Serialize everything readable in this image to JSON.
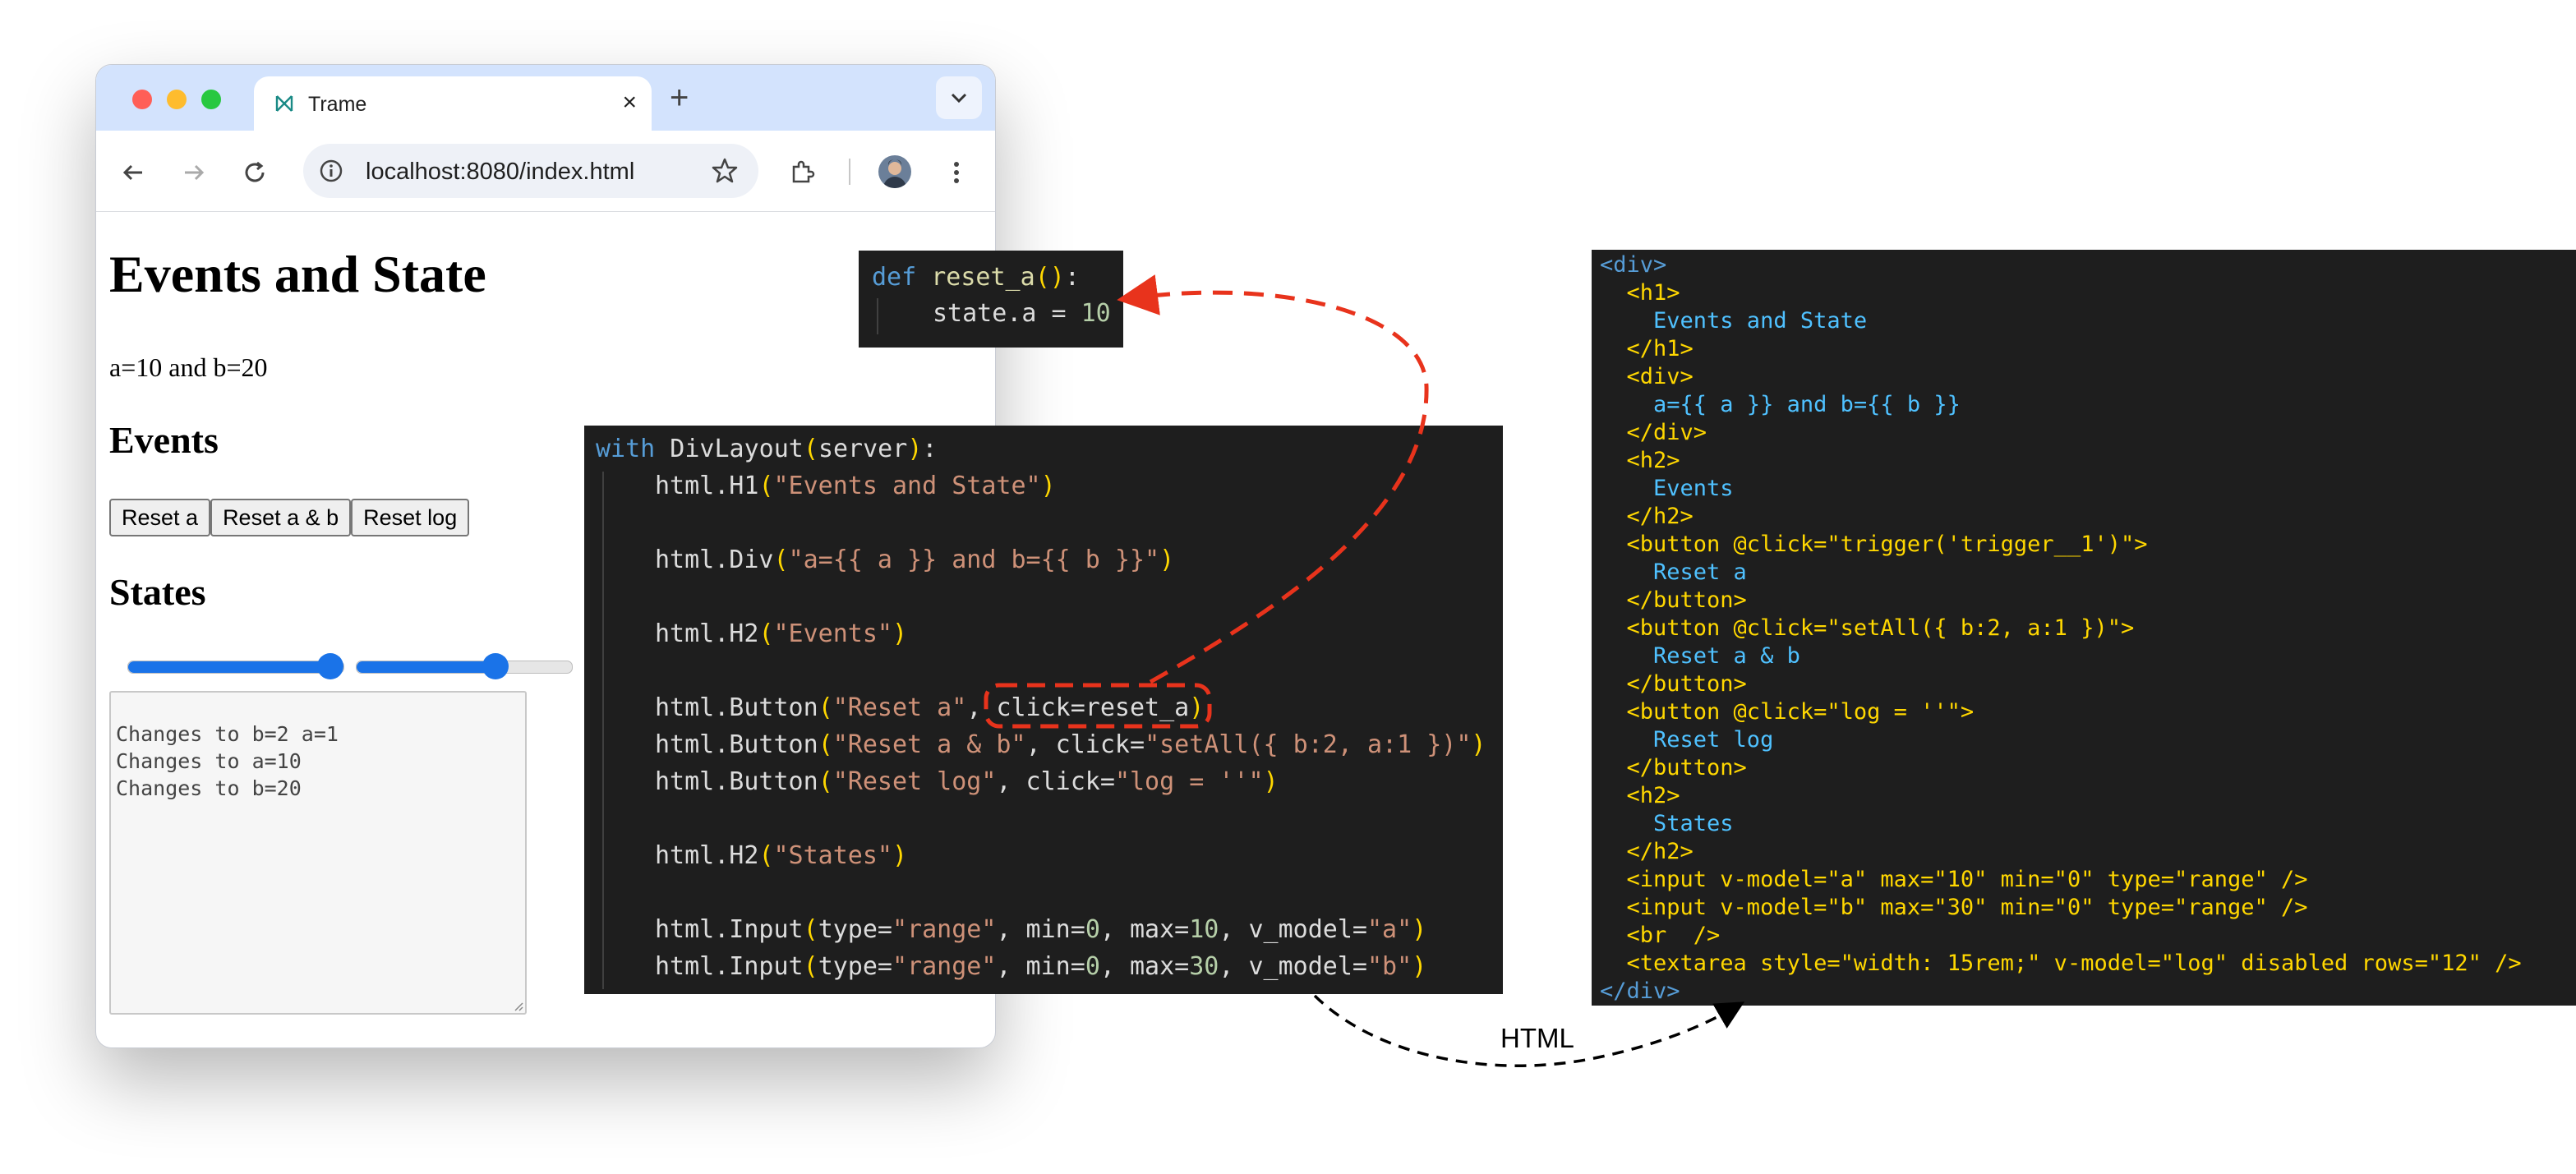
{
  "browser": {
    "tab_title": "Trame",
    "url": "localhost:8080/index.html",
    "colors": {
      "tabbar": "#d3e3fd",
      "accent": "#1a73e8"
    }
  },
  "page": {
    "h1": "Events and State",
    "ab_text": "a=10 and b=20",
    "events_heading": "Events",
    "buttons": [
      "Reset a",
      "Reset a & b",
      "Reset log"
    ],
    "states_heading": "States",
    "slider_a": {
      "value": 10,
      "min": 0,
      "max": 10
    },
    "slider_b": {
      "value": 20,
      "min": 0,
      "max": 30
    },
    "log": [
      "Changes to b=2 a=1",
      "Changes to a=10",
      "Changes to b=20"
    ]
  },
  "small_code": {
    "line1": {
      "kw": "def",
      "name": "reset_a",
      "paren": "()",
      "colon": ":"
    },
    "line2": {
      "text": "state.a = ",
      "num": "10"
    }
  },
  "python_code": {
    "l1": {
      "kw": "with",
      "plain": " DivLayout",
      "po": "(",
      "arg": "server",
      "pc": ")",
      "end": ":"
    },
    "l2": {
      "plain": "html.H1",
      "po": "(",
      "str": "\"Events and State\"",
      "pc": ")"
    },
    "l3": {
      "plain": "html.Div",
      "po": "(",
      "str": "\"a={{ a }} and b={{ b }}\"",
      "pc": ")"
    },
    "l4": {
      "plain": "html.H2",
      "po": "(",
      "str": "\"Events\"",
      "pc": ")"
    },
    "l5": {
      "plain": "html.Button",
      "po": "(",
      "str": "\"Reset a\"",
      "mid": ", ",
      "kwarg": "click=reset_a",
      "pc": ")"
    },
    "l6": {
      "plain": "html.Button",
      "po": "(",
      "str": "\"Reset a & b\"",
      "mid": ", click=",
      "str2": "\"setAll({ b:2, a:1 })\"",
      "pc": ")"
    },
    "l7": {
      "plain": "html.Button",
      "po": "(",
      "str": "\"Reset log\"",
      "mid": ", click=",
      "str2": "\"log = ''\"",
      "pc": ")"
    },
    "l8": {
      "plain": "html.H2",
      "po": "(",
      "str": "\"States\"",
      "pc": ")"
    },
    "l9": {
      "plain": "html.Input",
      "po": "(",
      "a": "type=",
      "s1": "\"range\"",
      "b": ", min=",
      "n1": "0",
      "c": ", max=",
      "n2": "10",
      "d": ", v_model=",
      "s2": "\"a\"",
      "pc": ")"
    },
    "l10": {
      "plain": "html.Input",
      "po": "(",
      "a": "type=",
      "s1": "\"range\"",
      "b": ", min=",
      "n1": "0",
      "c": ", max=",
      "n2": "30",
      "d": ", v_model=",
      "s2": "\"b\"",
      "pc": ")"
    }
  },
  "html_code": [
    {
      "cls": "tg",
      "text": "<div>"
    },
    {
      "cls": "at",
      "text": "  <h1>"
    },
    {
      "cls": "ht",
      "text": "    Events and State"
    },
    {
      "cls": "at",
      "text": "  </h1>"
    },
    {
      "cls": "at",
      "text": "  <div>"
    },
    {
      "cls": "ht",
      "text": "    a={{ a }} and b={{ b }}"
    },
    {
      "cls": "at",
      "text": "  </div>"
    },
    {
      "cls": "at",
      "text": "  <h2>"
    },
    {
      "cls": "ht",
      "text": "    Events"
    },
    {
      "cls": "at",
      "text": "  </h2>"
    },
    {
      "cls": "at",
      "text": "  <button @click=\"trigger('trigger__1')\">"
    },
    {
      "cls": "ht",
      "text": "    Reset a"
    },
    {
      "cls": "at",
      "text": "  </button>"
    },
    {
      "cls": "at",
      "text": "  <button @click=\"setAll({ b:2, a:1 })\">"
    },
    {
      "cls": "ht",
      "text": "    Reset a & b"
    },
    {
      "cls": "at",
      "text": "  </button>"
    },
    {
      "cls": "at",
      "text": "  <button @click=\"log = ''\">"
    },
    {
      "cls": "ht",
      "text": "    Reset log"
    },
    {
      "cls": "at",
      "text": "  </button>"
    },
    {
      "cls": "at",
      "text": "  <h2>"
    },
    {
      "cls": "ht",
      "text": "    States"
    },
    {
      "cls": "at",
      "text": "  </h2>"
    },
    {
      "cls": "at",
      "text": "  <input v-model=\"a\" max=\"10\" min=\"0\" type=\"range\" />"
    },
    {
      "cls": "at",
      "text": "  <input v-model=\"b\" max=\"30\" min=\"0\" type=\"range\" />"
    },
    {
      "cls": "at",
      "text": "  <br  />"
    },
    {
      "cls": "at",
      "text": "  <textarea style=\"width: 15rem;\" v-model=\"log\" disabled rows=\"12\" />"
    },
    {
      "cls": "tg",
      "text": "</div>"
    }
  ],
  "arrow_label": "HTML"
}
